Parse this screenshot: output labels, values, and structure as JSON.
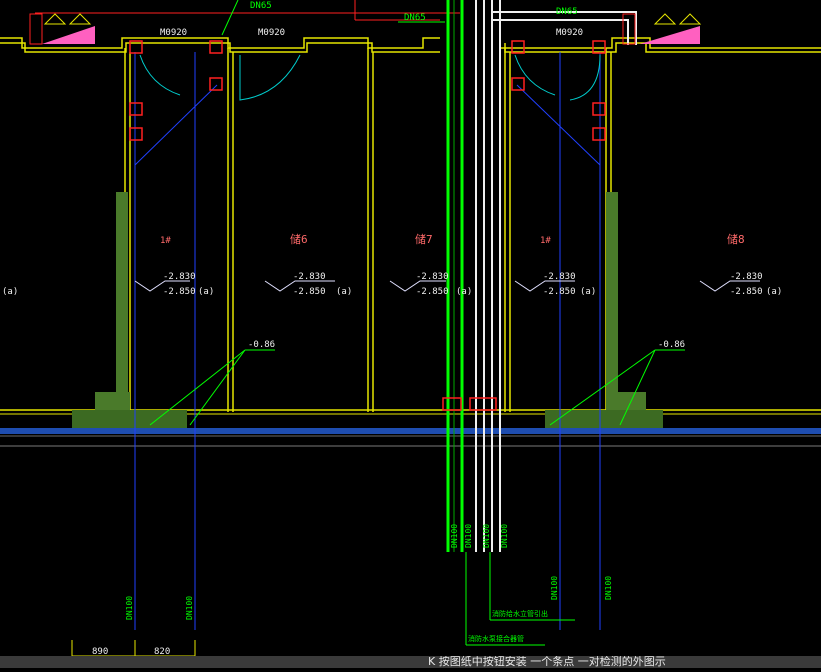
{
  "drawing": {
    "top_labels": {
      "dn65_a": "DN65",
      "dn65_b": "DN65",
      "dn65_c": "DN65"
    },
    "doors": {
      "m0920_a": "M0920",
      "m0920_b": "M0920",
      "m0920_c": "M0920"
    },
    "rooms": {
      "r1": "1#",
      "r2": "储6",
      "r3": "储7",
      "r4": "1#",
      "r5": "储8"
    },
    "levels": {
      "l1_top": "-2.830",
      "l1_bot": "-2.850",
      "l1_suffix": "(a)",
      "l2_top": "-2.830",
      "l2_bot": "-2.850",
      "l2_suffix": "(a)",
      "l3_top": "-2.830",
      "l3_bot": "-2.850",
      "l3_suffix": "(a)",
      "l4_top": "-2.830",
      "l4_bot": "-2.850",
      "l4_suffix": "(a)",
      "l5_top": "-2.830",
      "l5_bot": "-2.850",
      "l5_suffix": "(a)",
      "left_edge": "(a)"
    },
    "notes": {
      "n1": "-0.86",
      "n2": "-0.86"
    },
    "pipes": {
      "p1": "DN100",
      "p2": "DN100",
      "p3": "DN100",
      "p4": "DN100",
      "p5": "DN100",
      "p6": "DN100",
      "p7": "DN100",
      "p8": "DN100"
    },
    "dimensions": {
      "d1": "890",
      "d2": "820"
    },
    "callouts": {
      "c1": "消防给水立管引出",
      "c2": "消防水泵接合器管"
    }
  },
  "status_bar": {
    "text": "K 按图纸中按钮安装 一个条点 一对检测的外图示"
  },
  "colors": {
    "wall": "#e6e600",
    "pipe_green": "#00ff00",
    "pipe_white": "#f0f0f0",
    "dim_red": "#ff2020",
    "axis_blue": "#2040ff",
    "door_cyan": "#00cccc",
    "text": "#f0f0f0"
  }
}
